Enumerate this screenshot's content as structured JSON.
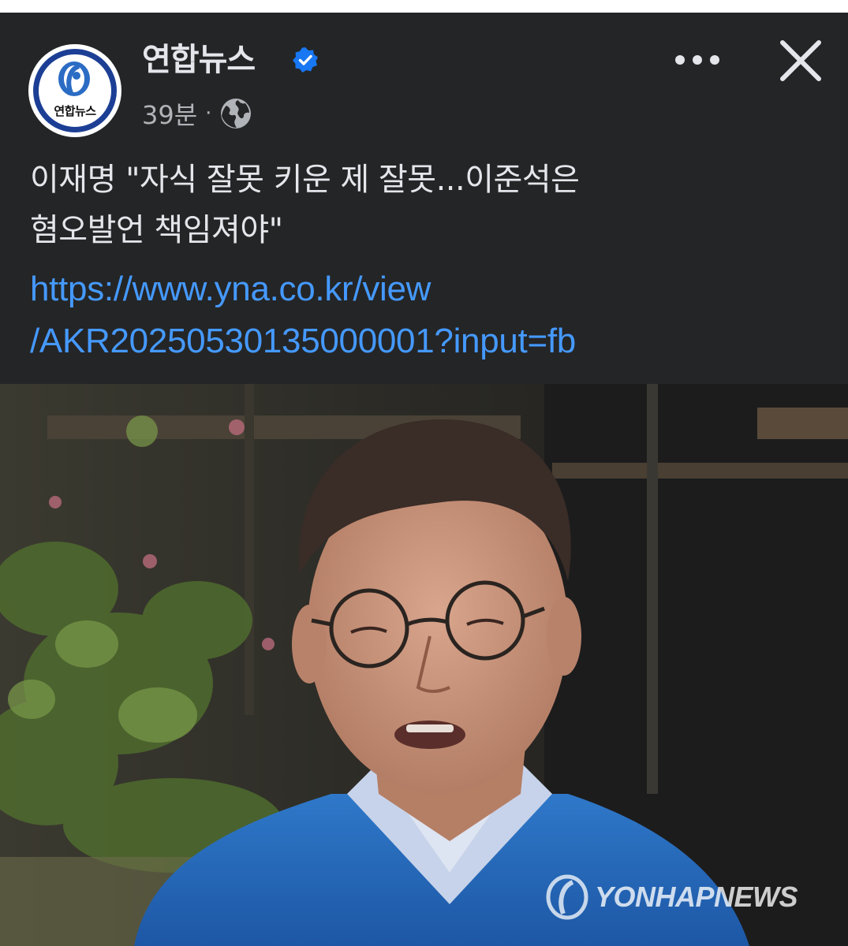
{
  "header": {
    "page_name": "연합뉴스",
    "avatar_text": "연합뉴스",
    "time": "39분",
    "separator": "·",
    "accent_color": "#1877f2"
  },
  "post": {
    "headline_line1": "이재명 \"자식 잘못 키운 제 잘못...이준석은",
    "headline_line2": "혐오발언 책임져야\"",
    "link_line1": "https://www.yna.co.kr/view",
    "link_line2": "/AKR20250530135000001?input=fb",
    "link_color": "#4599ff"
  },
  "photo": {
    "watermark": "YONHAPNEWS"
  },
  "icons": {
    "verified": "verified-badge-icon",
    "privacy": "globe-icon",
    "more": "more-options-icon",
    "close": "close-icon"
  }
}
